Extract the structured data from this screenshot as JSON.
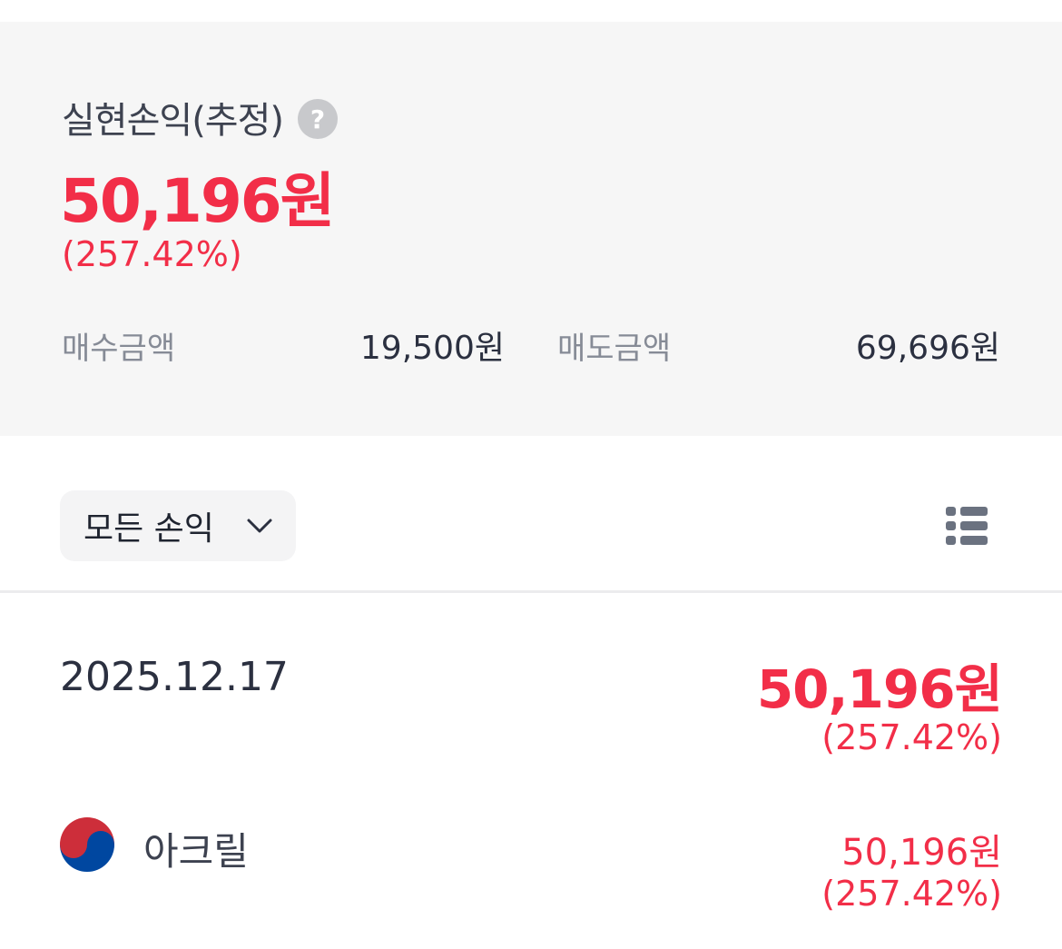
{
  "summary": {
    "title": "실현손익(추정)",
    "help_icon": "?",
    "amount": "50,196원",
    "rate": "(257.42%)",
    "buy_label": "매수금액",
    "buy_value": "19,500원",
    "sell_label": "매도금액",
    "sell_value": "69,696원"
  },
  "filter": {
    "label": "모든 손익",
    "chevron_icon": "chevron-down-icon",
    "view_icon": "list-view-icon"
  },
  "groups": [
    {
      "date": "2025.12.17",
      "amount": "50,196원",
      "rate": "(257.42%)",
      "items": [
        {
          "flag_icon": "korea-flag-icon",
          "name": "아크릴",
          "amount": "50,196원",
          "rate": "(257.42%)"
        }
      ]
    }
  ],
  "colors": {
    "profit": "#f22e48",
    "summary_bg": "#f6f6f6",
    "text_primary": "#2b3040",
    "text_secondary": "#868b96"
  }
}
